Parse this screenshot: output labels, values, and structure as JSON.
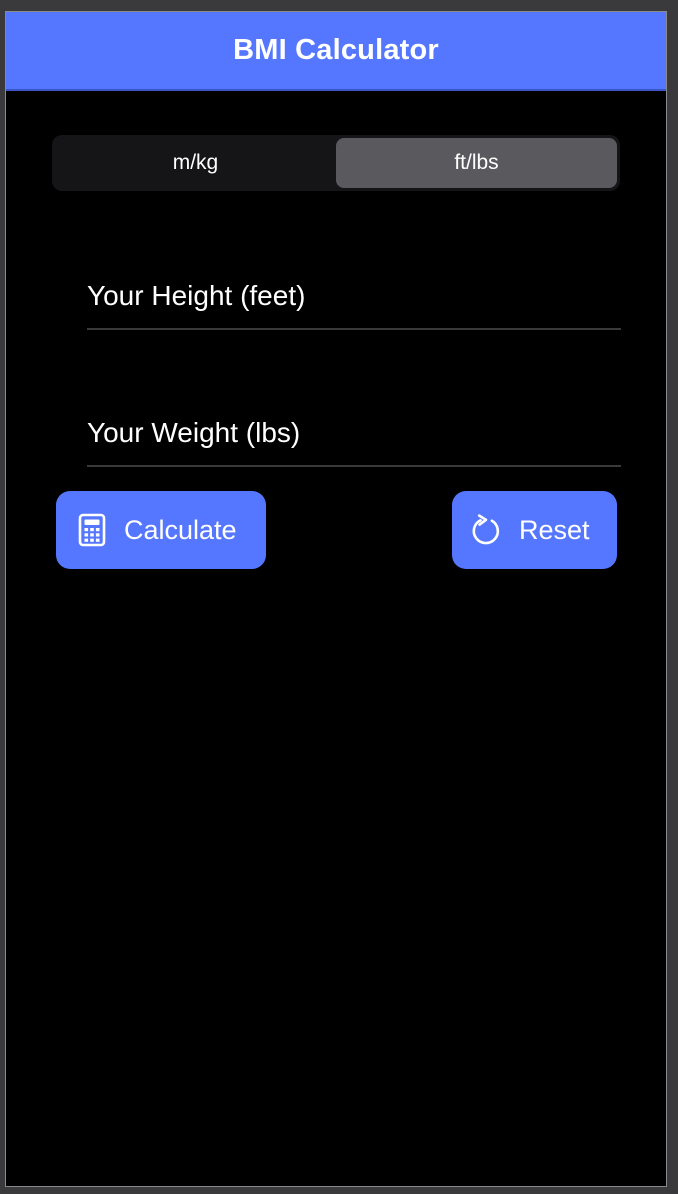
{
  "navbar": {
    "title": "BMI Calculator",
    "background_color": "#5577ff"
  },
  "unit_selector": {
    "options": [
      {
        "label": "m/kg",
        "selected": false
      },
      {
        "label": "ft/lbs",
        "selected": true
      }
    ]
  },
  "form": {
    "height": {
      "placeholder": "Your Height (feet)",
      "value": ""
    },
    "weight": {
      "placeholder": "Your Weight (lbs)",
      "value": ""
    }
  },
  "actions": {
    "calculate": {
      "label": "Calculate",
      "icon": "calculator-icon"
    },
    "reset": {
      "label": "Reset",
      "icon": "reload-icon"
    }
  },
  "colors": {
    "accent": "#5577ff",
    "background": "#000000",
    "segment_selected": "#5a5a5e",
    "text": "#ffffff"
  }
}
